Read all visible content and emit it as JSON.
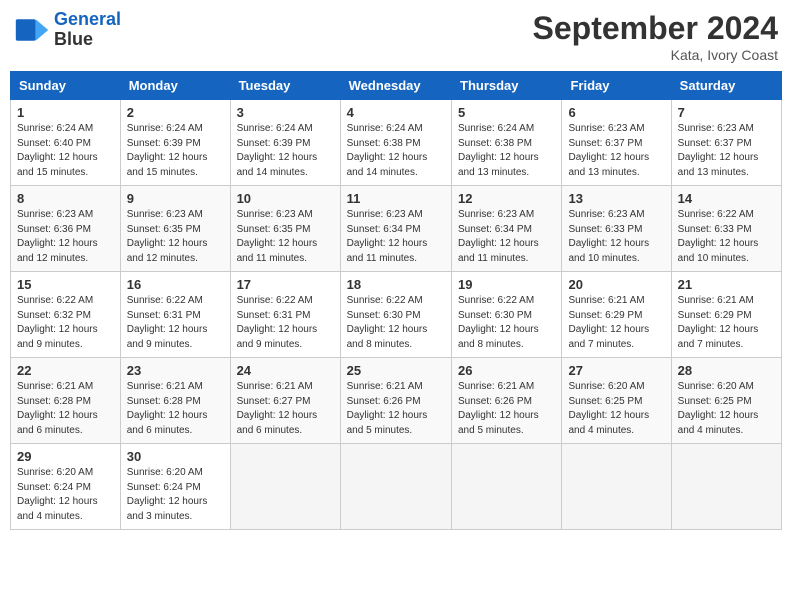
{
  "header": {
    "logo_line1": "General",
    "logo_line2": "Blue",
    "month_title": "September 2024",
    "location": "Kata, Ivory Coast"
  },
  "weekdays": [
    "Sunday",
    "Monday",
    "Tuesday",
    "Wednesday",
    "Thursday",
    "Friday",
    "Saturday"
  ],
  "weeks": [
    [
      {
        "day": "1",
        "sunrise": "6:24 AM",
        "sunset": "6:40 PM",
        "daylight": "12 hours and 15 minutes."
      },
      {
        "day": "2",
        "sunrise": "6:24 AM",
        "sunset": "6:39 PM",
        "daylight": "12 hours and 15 minutes."
      },
      {
        "day": "3",
        "sunrise": "6:24 AM",
        "sunset": "6:39 PM",
        "daylight": "12 hours and 14 minutes."
      },
      {
        "day": "4",
        "sunrise": "6:24 AM",
        "sunset": "6:38 PM",
        "daylight": "12 hours and 14 minutes."
      },
      {
        "day": "5",
        "sunrise": "6:24 AM",
        "sunset": "6:38 PM",
        "daylight": "12 hours and 13 minutes."
      },
      {
        "day": "6",
        "sunrise": "6:23 AM",
        "sunset": "6:37 PM",
        "daylight": "12 hours and 13 minutes."
      },
      {
        "day": "7",
        "sunrise": "6:23 AM",
        "sunset": "6:37 PM",
        "daylight": "12 hours and 13 minutes."
      }
    ],
    [
      {
        "day": "8",
        "sunrise": "6:23 AM",
        "sunset": "6:36 PM",
        "daylight": "12 hours and 12 minutes."
      },
      {
        "day": "9",
        "sunrise": "6:23 AM",
        "sunset": "6:35 PM",
        "daylight": "12 hours and 12 minutes."
      },
      {
        "day": "10",
        "sunrise": "6:23 AM",
        "sunset": "6:35 PM",
        "daylight": "12 hours and 11 minutes."
      },
      {
        "day": "11",
        "sunrise": "6:23 AM",
        "sunset": "6:34 PM",
        "daylight": "12 hours and 11 minutes."
      },
      {
        "day": "12",
        "sunrise": "6:23 AM",
        "sunset": "6:34 PM",
        "daylight": "12 hours and 11 minutes."
      },
      {
        "day": "13",
        "sunrise": "6:23 AM",
        "sunset": "6:33 PM",
        "daylight": "12 hours and 10 minutes."
      },
      {
        "day": "14",
        "sunrise": "6:22 AM",
        "sunset": "6:33 PM",
        "daylight": "12 hours and 10 minutes."
      }
    ],
    [
      {
        "day": "15",
        "sunrise": "6:22 AM",
        "sunset": "6:32 PM",
        "daylight": "12 hours and 9 minutes."
      },
      {
        "day": "16",
        "sunrise": "6:22 AM",
        "sunset": "6:31 PM",
        "daylight": "12 hours and 9 minutes."
      },
      {
        "day": "17",
        "sunrise": "6:22 AM",
        "sunset": "6:31 PM",
        "daylight": "12 hours and 9 minutes."
      },
      {
        "day": "18",
        "sunrise": "6:22 AM",
        "sunset": "6:30 PM",
        "daylight": "12 hours and 8 minutes."
      },
      {
        "day": "19",
        "sunrise": "6:22 AM",
        "sunset": "6:30 PM",
        "daylight": "12 hours and 8 minutes."
      },
      {
        "day": "20",
        "sunrise": "6:21 AM",
        "sunset": "6:29 PM",
        "daylight": "12 hours and 7 minutes."
      },
      {
        "day": "21",
        "sunrise": "6:21 AM",
        "sunset": "6:29 PM",
        "daylight": "12 hours and 7 minutes."
      }
    ],
    [
      {
        "day": "22",
        "sunrise": "6:21 AM",
        "sunset": "6:28 PM",
        "daylight": "12 hours and 6 minutes."
      },
      {
        "day": "23",
        "sunrise": "6:21 AM",
        "sunset": "6:28 PM",
        "daylight": "12 hours and 6 minutes."
      },
      {
        "day": "24",
        "sunrise": "6:21 AM",
        "sunset": "6:27 PM",
        "daylight": "12 hours and 6 minutes."
      },
      {
        "day": "25",
        "sunrise": "6:21 AM",
        "sunset": "6:26 PM",
        "daylight": "12 hours and 5 minutes."
      },
      {
        "day": "26",
        "sunrise": "6:21 AM",
        "sunset": "6:26 PM",
        "daylight": "12 hours and 5 minutes."
      },
      {
        "day": "27",
        "sunrise": "6:20 AM",
        "sunset": "6:25 PM",
        "daylight": "12 hours and 4 minutes."
      },
      {
        "day": "28",
        "sunrise": "6:20 AM",
        "sunset": "6:25 PM",
        "daylight": "12 hours and 4 minutes."
      }
    ],
    [
      {
        "day": "29",
        "sunrise": "6:20 AM",
        "sunset": "6:24 PM",
        "daylight": "12 hours and 4 minutes."
      },
      {
        "day": "30",
        "sunrise": "6:20 AM",
        "sunset": "6:24 PM",
        "daylight": "12 hours and 3 minutes."
      },
      null,
      null,
      null,
      null,
      null
    ]
  ]
}
